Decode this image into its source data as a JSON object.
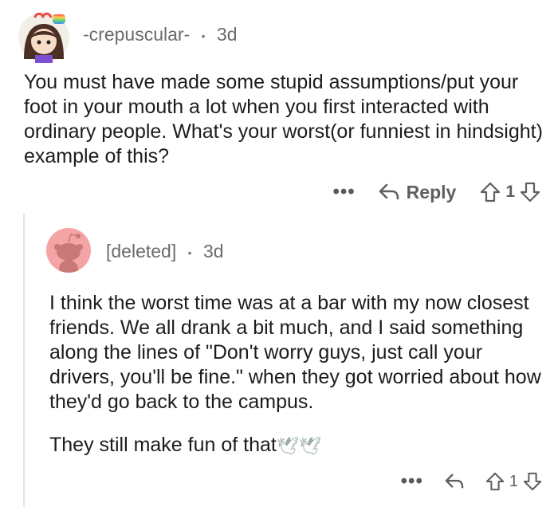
{
  "parent": {
    "username": "-crepuscular-",
    "separator": "•",
    "age": "3d",
    "text": "You must have made some stupid assumptions/put your foot in your mouth a lot when you first interacted with ordinary people.  What's your worst(or funniest in hindsight) example of this?",
    "more_label": "•••",
    "reply_label": "Reply",
    "vote_count": "1"
  },
  "child": {
    "username": "[deleted]",
    "separator": "•",
    "age": "3d",
    "text": "I think the worst time was at a bar with my now closest friends. We all drank a bit much, and I said something along the lines of \"Don't worry guys, just call your drivers, you'll be fine.\" when they got worried about how they'd go back to the campus.",
    "text2": "They still make fun of that",
    "emoji": "🕊🕊",
    "more_label": "•••",
    "vote_count": "1"
  },
  "colors": {
    "deleted_avatar": "#f4a4a4",
    "thread_line": "#e3e3e3"
  },
  "icons": [
    "avatar-girl",
    "reply-arrow-icon",
    "upvote-icon",
    "downvote-icon",
    "reddit-snoo-icon",
    "dove-emoji"
  ]
}
